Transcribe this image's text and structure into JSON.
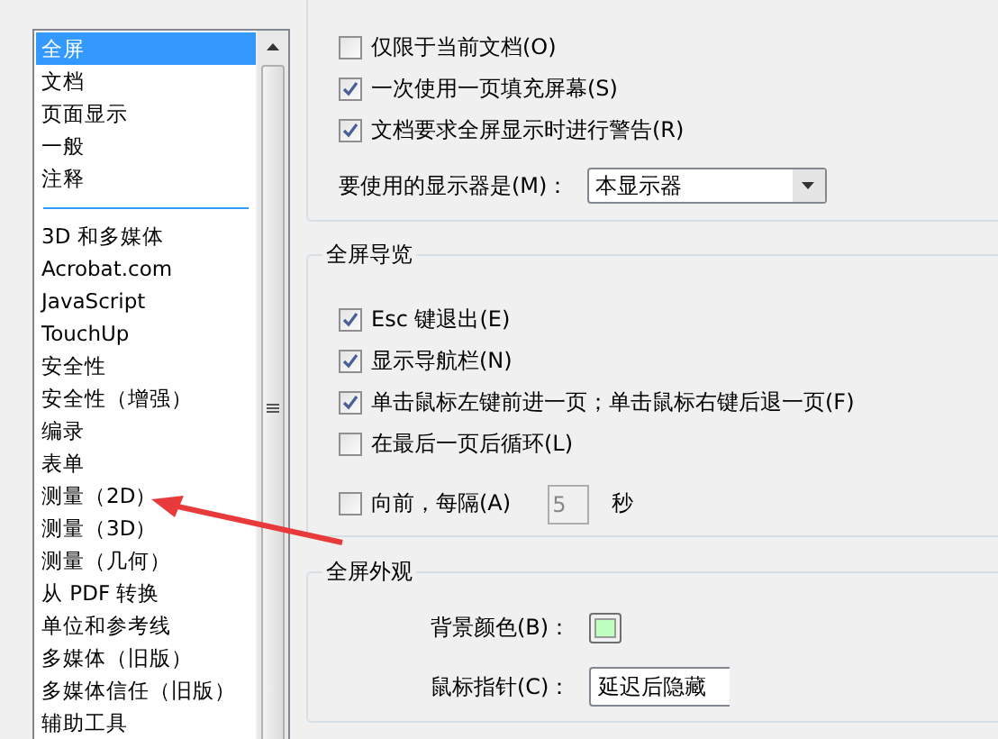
{
  "categories": {
    "items": [
      {
        "kind": "item",
        "label": "全屏",
        "selected": true
      },
      {
        "kind": "item",
        "label": "文档",
        "selected": false
      },
      {
        "kind": "item",
        "label": "页面显示",
        "selected": false
      },
      {
        "kind": "item",
        "label": "一般",
        "selected": false
      },
      {
        "kind": "item",
        "label": "注释",
        "selected": false
      },
      {
        "kind": "separator"
      },
      {
        "kind": "item",
        "label": "3D 和多媒体",
        "selected": false
      },
      {
        "kind": "item",
        "label": "Acrobat.com",
        "selected": false
      },
      {
        "kind": "item",
        "label": "JavaScript",
        "selected": false
      },
      {
        "kind": "item",
        "label": "TouchUp",
        "selected": false
      },
      {
        "kind": "item",
        "label": "安全性",
        "selected": false
      },
      {
        "kind": "item",
        "label": "安全性（增强）",
        "selected": false
      },
      {
        "kind": "item",
        "label": "编录",
        "selected": false
      },
      {
        "kind": "item",
        "label": "表单",
        "selected": false
      },
      {
        "kind": "item",
        "label": "测量（2D）",
        "selected": false
      },
      {
        "kind": "item",
        "label": "测量（3D）",
        "selected": false
      },
      {
        "kind": "item",
        "label": "测量（几何）",
        "selected": false
      },
      {
        "kind": "item",
        "label": "从 PDF 转换",
        "selected": false
      },
      {
        "kind": "item",
        "label": "单位和参考线",
        "selected": false
      },
      {
        "kind": "item",
        "label": "多媒体（旧版）",
        "selected": false
      },
      {
        "kind": "item",
        "label": "多媒体信任（旧版）",
        "selected": false
      },
      {
        "kind": "item",
        "label": "辅助工具",
        "selected": false
      }
    ]
  },
  "full_screen_setup": {
    "checkboxes": [
      {
        "label": "仅限于当前文档(O)",
        "checked": false
      },
      {
        "label": "一次使用一页填充屏幕(S)",
        "checked": true
      },
      {
        "label": "文档要求全屏显示时进行警告(R)",
        "checked": true
      }
    ],
    "monitor": {
      "label": "要使用的显示器是(M)：",
      "value": "本显示器"
    }
  },
  "full_screen_navigation": {
    "title": "全屏导览",
    "checkboxes": [
      {
        "label": "Esc 键退出(E)",
        "checked": true
      },
      {
        "label": "显示导航栏(N)",
        "checked": true
      },
      {
        "label": "单击鼠标左键前进一页；单击鼠标右键后退一页(F)",
        "checked": true
      },
      {
        "label": "在最后一页后循环(L)",
        "checked": false
      }
    ],
    "advance": {
      "label": "向前，每隔(A)",
      "checked": false,
      "value": "5",
      "disabled": true,
      "unit": "秒"
    }
  },
  "full_screen_appearance": {
    "title": "全屏外观",
    "background_color": {
      "label": "背景颜色(B)：",
      "color": "#c0ffc0"
    },
    "mouse_cursor": {
      "label": "鼠标指针(C)：",
      "value": "延迟后隐藏"
    }
  },
  "annotation": {
    "kind": "arrow"
  }
}
